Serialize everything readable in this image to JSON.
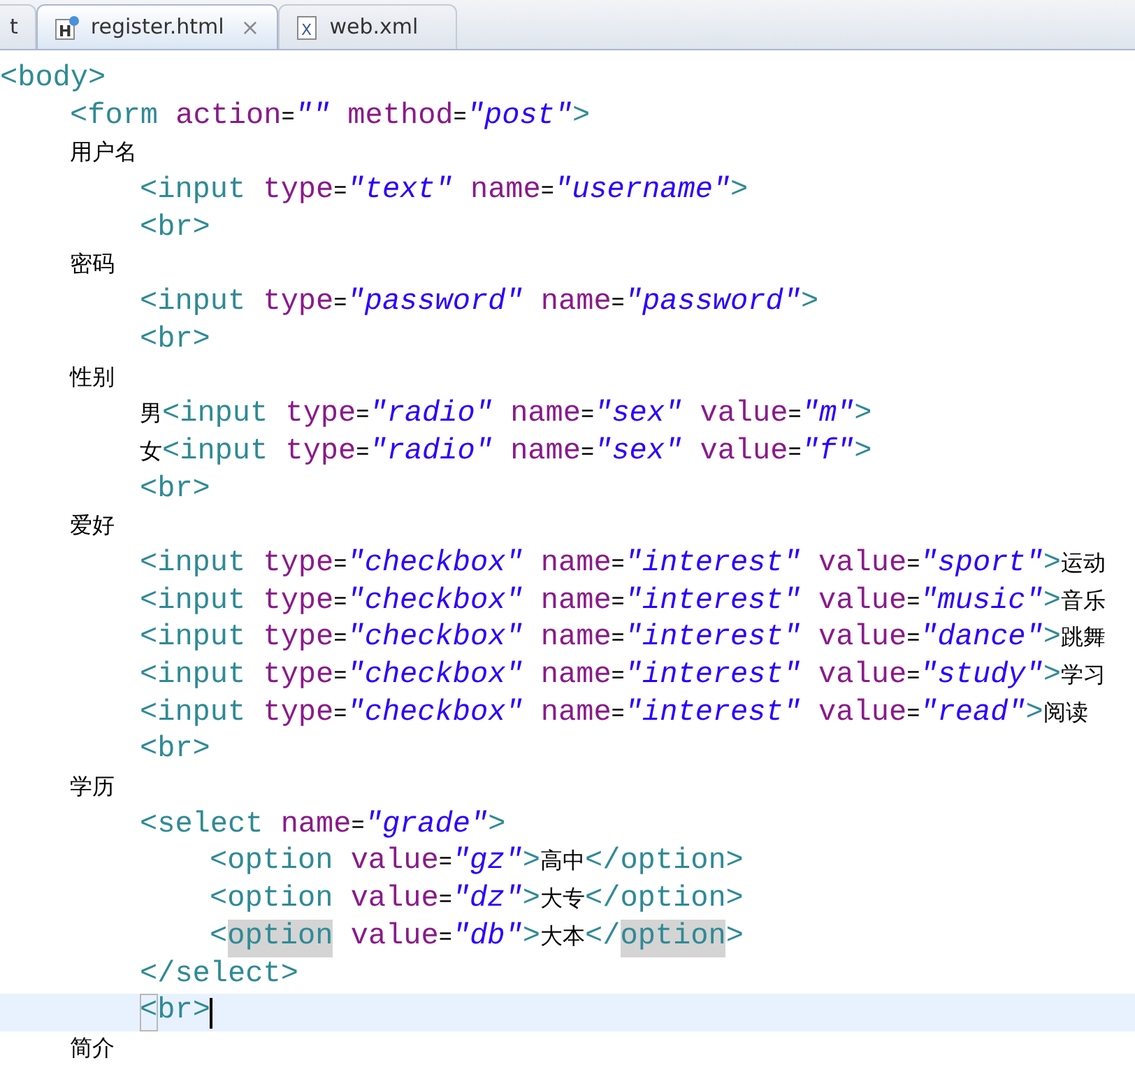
{
  "tabs": [
    {
      "label": "t",
      "kind": "partial",
      "selected": false
    },
    {
      "label": "register.html",
      "kind": "html",
      "icon_letter": "H",
      "selected": true,
      "close": "×"
    },
    {
      "label": "web.xml",
      "kind": "xml",
      "icon_letter": "X",
      "selected": false
    }
  ],
  "lines": [
    {
      "current": false,
      "tokens": [
        {
          "kind": "tag",
          "text": "<body>"
        }
      ],
      "children": [
        {
          "current": false,
          "tokens": [
            {
              "kind": "tag",
              "text": "<form"
            },
            {
              "kind": "attr",
              "text": " action"
            },
            {
              "kind": "text",
              "text": "="
            },
            {
              "kind": "value",
              "text": "\"\""
            },
            {
              "kind": "attr",
              "text": " method"
            },
            {
              "kind": "text",
              "text": "="
            },
            {
              "kind": "value",
              "text": "\"post\""
            },
            {
              "kind": "tag",
              "text": ">"
            }
          ]
        },
        {
          "current": false,
          "tokens": [
            {
              "kind": "text",
              "text": "用户名"
            }
          ],
          "children": [
            {
              "current": false,
              "tokens": [
                {
                  "kind": "tag",
                  "text": "<input"
                },
                {
                  "kind": "attr",
                  "text": " type"
                },
                {
                  "kind": "text",
                  "text": "="
                },
                {
                  "kind": "value",
                  "text": "\"text\""
                },
                {
                  "kind": "attr",
                  "text": " name"
                },
                {
                  "kind": "text",
                  "text": "="
                },
                {
                  "kind": "value",
                  "text": "\"username\""
                },
                {
                  "kind": "tag",
                  "text": ">"
                }
              ]
            },
            {
              "current": false,
              "tokens": [
                {
                  "kind": "tag",
                  "text": "<br>"
                }
              ]
            }
          ]
        },
        {
          "current": false,
          "tokens": [
            {
              "kind": "text",
              "text": "密码"
            }
          ],
          "children": [
            {
              "current": false,
              "tokens": [
                {
                  "kind": "tag",
                  "text": "<input"
                },
                {
                  "kind": "attr",
                  "text": " type"
                },
                {
                  "kind": "text",
                  "text": "="
                },
                {
                  "kind": "value",
                  "text": "\"password\""
                },
                {
                  "kind": "attr",
                  "text": " name"
                },
                {
                  "kind": "text",
                  "text": "="
                },
                {
                  "kind": "value",
                  "text": "\"password\""
                },
                {
                  "kind": "tag",
                  "text": ">"
                }
              ]
            },
            {
              "current": false,
              "tokens": [
                {
                  "kind": "tag",
                  "text": "<br>"
                }
              ]
            }
          ]
        },
        {
          "current": false,
          "tokens": [
            {
              "kind": "text",
              "text": "性别"
            }
          ],
          "children": [
            {
              "current": false,
              "tokens": [
                {
                  "kind": "text",
                  "text": "男"
                },
                {
                  "kind": "tag",
                  "text": "<input"
                },
                {
                  "kind": "attr",
                  "text": " type"
                },
                {
                  "kind": "text",
                  "text": "="
                },
                {
                  "kind": "value",
                  "text": "\"radio\""
                },
                {
                  "kind": "attr",
                  "text": " name"
                },
                {
                  "kind": "text",
                  "text": "="
                },
                {
                  "kind": "value",
                  "text": "\"sex\""
                },
                {
                  "kind": "attr",
                  "text": " value"
                },
                {
                  "kind": "text",
                  "text": "="
                },
                {
                  "kind": "value",
                  "text": "\"m\""
                },
                {
                  "kind": "tag",
                  "text": ">"
                }
              ]
            },
            {
              "current": false,
              "tokens": [
                {
                  "kind": "text",
                  "text": "女"
                },
                {
                  "kind": "tag",
                  "text": "<input"
                },
                {
                  "kind": "attr",
                  "text": " type"
                },
                {
                  "kind": "text",
                  "text": "="
                },
                {
                  "kind": "value",
                  "text": "\"radio\""
                },
                {
                  "kind": "attr",
                  "text": " name"
                },
                {
                  "kind": "text",
                  "text": "="
                },
                {
                  "kind": "value",
                  "text": "\"sex\""
                },
                {
                  "kind": "attr",
                  "text": " value"
                },
                {
                  "kind": "text",
                  "text": "="
                },
                {
                  "kind": "value",
                  "text": "\"f\""
                },
                {
                  "kind": "tag",
                  "text": ">"
                }
              ]
            },
            {
              "current": false,
              "tokens": [
                {
                  "kind": "tag",
                  "text": "<br>"
                }
              ]
            }
          ]
        },
        {
          "current": false,
          "tokens": [
            {
              "kind": "text",
              "text": "爱好"
            }
          ],
          "children": [
            {
              "current": false,
              "tokens": [
                {
                  "kind": "tag",
                  "text": "<input"
                },
                {
                  "kind": "attr",
                  "text": " type"
                },
                {
                  "kind": "text",
                  "text": "="
                },
                {
                  "kind": "value",
                  "text": "\"checkbox\""
                },
                {
                  "kind": "attr",
                  "text": " name"
                },
                {
                  "kind": "text",
                  "text": "="
                },
                {
                  "kind": "value",
                  "text": "\"interest\""
                },
                {
                  "kind": "attr",
                  "text": " value"
                },
                {
                  "kind": "text",
                  "text": "="
                },
                {
                  "kind": "value",
                  "text": "\"sport\""
                },
                {
                  "kind": "tag",
                  "text": ">"
                },
                {
                  "kind": "text",
                  "text": "运动"
                }
              ]
            },
            {
              "current": false,
              "tokens": [
                {
                  "kind": "tag",
                  "text": "<input"
                },
                {
                  "kind": "attr",
                  "text": " type"
                },
                {
                  "kind": "text",
                  "text": "="
                },
                {
                  "kind": "value",
                  "text": "\"checkbox\""
                },
                {
                  "kind": "attr",
                  "text": " name"
                },
                {
                  "kind": "text",
                  "text": "="
                },
                {
                  "kind": "value",
                  "text": "\"interest\""
                },
                {
                  "kind": "attr",
                  "text": " value"
                },
                {
                  "kind": "text",
                  "text": "="
                },
                {
                  "kind": "value",
                  "text": "\"music\""
                },
                {
                  "kind": "tag",
                  "text": ">"
                },
                {
                  "kind": "text",
                  "text": "音乐"
                }
              ]
            },
            {
              "current": false,
              "tokens": [
                {
                  "kind": "tag",
                  "text": "<input"
                },
                {
                  "kind": "attr",
                  "text": " type"
                },
                {
                  "kind": "text",
                  "text": "="
                },
                {
                  "kind": "value",
                  "text": "\"checkbox\""
                },
                {
                  "kind": "attr",
                  "text": " name"
                },
                {
                  "kind": "text",
                  "text": "="
                },
                {
                  "kind": "value",
                  "text": "\"interest\""
                },
                {
                  "kind": "attr",
                  "text": " value"
                },
                {
                  "kind": "text",
                  "text": "="
                },
                {
                  "kind": "value",
                  "text": "\"dance\""
                },
                {
                  "kind": "tag",
                  "text": ">"
                },
                {
                  "kind": "text",
                  "text": "跳舞"
                }
              ]
            },
            {
              "current": false,
              "tokens": [
                {
                  "kind": "tag",
                  "text": "<input"
                },
                {
                  "kind": "attr",
                  "text": " type"
                },
                {
                  "kind": "text",
                  "text": "="
                },
                {
                  "kind": "value",
                  "text": "\"checkbox\""
                },
                {
                  "kind": "attr",
                  "text": " name"
                },
                {
                  "kind": "text",
                  "text": "="
                },
                {
                  "kind": "value",
                  "text": "\"interest\""
                },
                {
                  "kind": "attr",
                  "text": " value"
                },
                {
                  "kind": "text",
                  "text": "="
                },
                {
                  "kind": "value",
                  "text": "\"study\""
                },
                {
                  "kind": "tag",
                  "text": ">"
                },
                {
                  "kind": "text",
                  "text": "学习"
                }
              ]
            },
            {
              "current": false,
              "tokens": [
                {
                  "kind": "tag",
                  "text": "<input"
                },
                {
                  "kind": "attr",
                  "text": " type"
                },
                {
                  "kind": "text",
                  "text": "="
                },
                {
                  "kind": "value",
                  "text": "\"checkbox\""
                },
                {
                  "kind": "attr",
                  "text": " name"
                },
                {
                  "kind": "text",
                  "text": "="
                },
                {
                  "kind": "value",
                  "text": "\"interest\""
                },
                {
                  "kind": "attr",
                  "text": " value"
                },
                {
                  "kind": "text",
                  "text": "="
                },
                {
                  "kind": "value",
                  "text": "\"read\""
                },
                {
                  "kind": "tag",
                  "text": ">"
                },
                {
                  "kind": "text",
                  "text": "阅读"
                }
              ]
            },
            {
              "current": false,
              "tokens": [
                {
                  "kind": "tag",
                  "text": "<br>"
                }
              ]
            }
          ]
        },
        {
          "current": false,
          "tokens": [
            {
              "kind": "text",
              "text": "学历"
            }
          ],
          "children": [
            {
              "current": false,
              "tokens": [
                {
                  "kind": "tag",
                  "text": "<select"
                },
                {
                  "kind": "attr",
                  "text": " name"
                },
                {
                  "kind": "text",
                  "text": "="
                },
                {
                  "kind": "value",
                  "text": "\"grade\""
                },
                {
                  "kind": "tag",
                  "text": ">"
                }
              ],
              "children": [
                {
                  "current": false,
                  "tokens": [
                    {
                      "kind": "tag",
                      "text": "<option"
                    },
                    {
                      "kind": "attr",
                      "text": " value"
                    },
                    {
                      "kind": "text",
                      "text": "="
                    },
                    {
                      "kind": "value",
                      "text": "\"gz\""
                    },
                    {
                      "kind": "tag",
                      "text": ">"
                    },
                    {
                      "kind": "text",
                      "text": "高中"
                    },
                    {
                      "kind": "tag",
                      "text": "</option>"
                    }
                  ]
                },
                {
                  "current": false,
                  "tokens": [
                    {
                      "kind": "tag",
                      "text": "<option"
                    },
                    {
                      "kind": "attr",
                      "text": " value"
                    },
                    {
                      "kind": "text",
                      "text": "="
                    },
                    {
                      "kind": "value",
                      "text": "\"dz\""
                    },
                    {
                      "kind": "tag",
                      "text": ">"
                    },
                    {
                      "kind": "text",
                      "text": "大专"
                    },
                    {
                      "kind": "tag",
                      "text": "</option>"
                    }
                  ]
                },
                {
                  "current": false,
                  "tokens": [
                    {
                      "kind": "tag",
                      "text": "<"
                    },
                    {
                      "kind": "match",
                      "text": "option"
                    },
                    {
                      "kind": "attr",
                      "text": " value"
                    },
                    {
                      "kind": "text",
                      "text": "="
                    },
                    {
                      "kind": "value",
                      "text": "\"db\""
                    },
                    {
                      "kind": "tag",
                      "text": ">"
                    },
                    {
                      "kind": "text",
                      "text": "大本"
                    },
                    {
                      "kind": "tag",
                      "text": "</"
                    },
                    {
                      "kind": "match",
                      "text": "option"
                    },
                    {
                      "kind": "tag",
                      "text": ">"
                    }
                  ]
                }
              ]
            },
            {
              "current": false,
              "tokens": [
                {
                  "kind": "tag",
                  "text": "</select>"
                }
              ]
            },
            {
              "current": true,
              "tokens": [
                {
                  "kind": "bracket",
                  "text": "<"
                },
                {
                  "kind": "tag",
                  "text": "br>"
                }
              ]
            }
          ]
        },
        {
          "current": false,
          "tokens": [
            {
              "kind": "text",
              "text": "简介"
            }
          ]
        }
      ]
    }
  ]
}
